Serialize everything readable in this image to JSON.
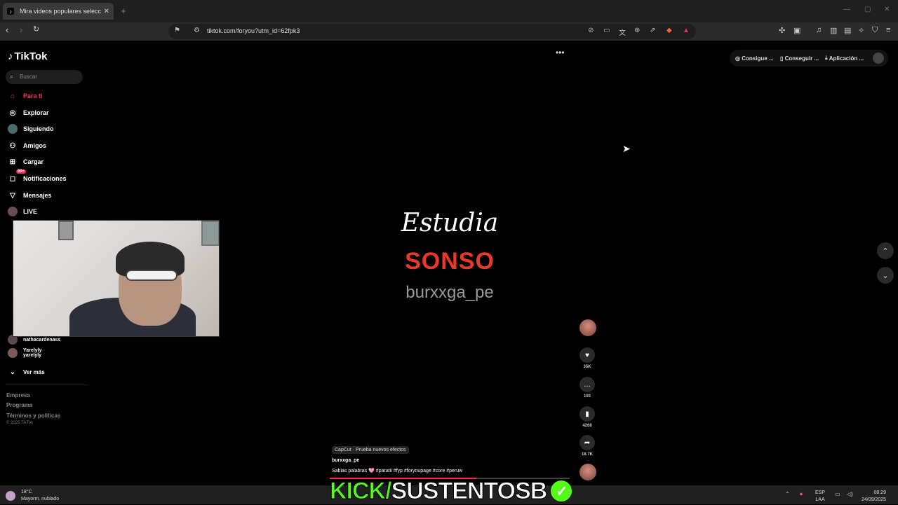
{
  "browser": {
    "tab_title": "Mira videos populares selecc",
    "url": "tiktok.com/foryou?utm_id=62fpk3"
  },
  "tiktok": {
    "logo": "TikTok",
    "search_placeholder": "Buscar",
    "nav": [
      {
        "label": "Para ti",
        "icon": "home-icon"
      },
      {
        "label": "Explorar",
        "icon": "compass-icon"
      },
      {
        "label": "Siguiendo",
        "icon": "following-icon"
      },
      {
        "label": "Amigos",
        "icon": "friends-icon"
      },
      {
        "label": "Cargar",
        "icon": "upload-icon"
      },
      {
        "label": "Notificaciones",
        "icon": "bell-icon",
        "badge": "99+"
      },
      {
        "label": "Mensajes",
        "icon": "send-icon"
      },
      {
        "label": "LIVE",
        "icon": "live-icon"
      }
    ],
    "following": [
      {
        "name": "nathacardenass"
      },
      {
        "name": "Yarelyly",
        "sub": "yarelyly"
      }
    ],
    "see_more": "Ver más",
    "footer": [
      "Empresa",
      "Programa",
      "Términos y políticas"
    ],
    "copyright": "© 2025 TikTok",
    "top_right": [
      "Consigue ...",
      "Conseguir ...",
      "Aplicación ..."
    ]
  },
  "video": {
    "word1": "Estudia",
    "word2": "SONSO",
    "word3": "burxxga_pe",
    "capcut": "CapCut · Prueba nuevos efectos",
    "username": "burxxga_pe",
    "description": "Sabias palabras 🩷 #paratii #fyp #foryoupage #core #peruw",
    "progress": 0.61,
    "likes": "35K",
    "comments": "193",
    "saves": "4268",
    "shares": "18.7K"
  },
  "overlay": {
    "kick_part1": "KICK/",
    "kick_part2": "SUSTENTOSB"
  },
  "taskbar": {
    "temp": "18°C",
    "weather": "Mayorm. nublado",
    "lang1": "ESP",
    "lang2": "LAA",
    "time": "08:29",
    "date": "24/09/2025"
  },
  "colors": {
    "accent": "#fe2c55",
    "kick": "#53fc18",
    "sonso": "#e8392a"
  }
}
